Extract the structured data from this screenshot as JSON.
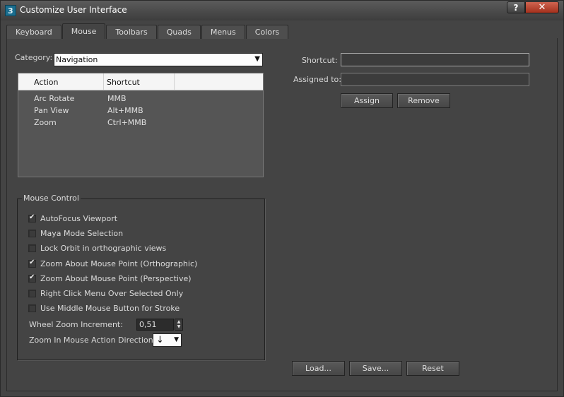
{
  "window": {
    "title": "Customize User Interface",
    "help_glyph": "?",
    "close_glyph": "✕"
  },
  "tabs": [
    {
      "label": "Keyboard",
      "active": false
    },
    {
      "label": "Mouse",
      "active": true
    },
    {
      "label": "Toolbars",
      "active": false
    },
    {
      "label": "Quads",
      "active": false
    },
    {
      "label": "Menus",
      "active": false
    },
    {
      "label": "Colors",
      "active": false
    }
  ],
  "category": {
    "label": "Category:",
    "value": "Navigation"
  },
  "action_list": {
    "columns": [
      "Action",
      "Shortcut"
    ],
    "rows": [
      {
        "action": "Arc Rotate",
        "shortcut": "MMB"
      },
      {
        "action": "Pan View",
        "shortcut": "Alt+MMB"
      },
      {
        "action": "Zoom",
        "shortcut": "Ctrl+MMB"
      }
    ]
  },
  "shortcut_panel": {
    "shortcut_label": "Shortcut:",
    "shortcut_value": "",
    "assigned_label": "Assigned to:",
    "assigned_value": "",
    "assign_button": "Assign",
    "remove_button": "Remove"
  },
  "mouse_control": {
    "title": "Mouse Control",
    "options": [
      {
        "label": "AutoFocus Viewport",
        "checked": true
      },
      {
        "label": "Maya Mode Selection",
        "checked": false
      },
      {
        "label": "Lock Orbit in orthographic views",
        "checked": false
      },
      {
        "label": "Zoom About Mouse Point (Orthographic)",
        "checked": true
      },
      {
        "label": "Zoom About Mouse Point (Perspective)",
        "checked": true
      },
      {
        "label": "Right Click Menu Over Selected Only",
        "checked": false
      },
      {
        "label": "Use Middle Mouse Button for Stroke",
        "checked": false
      }
    ],
    "wheel_zoom_label": "Wheel Zoom Increment:",
    "wheel_zoom_value": "0,51",
    "zoom_direction_label": "Zoom In Mouse Action Direction:",
    "zoom_direction_value": "↓"
  },
  "footer": {
    "load_button": "Load...",
    "save_button": "Save...",
    "reset_button": "Reset"
  },
  "colors": {
    "background": "#444444",
    "close_button": "#c0412b",
    "icon_accent": "#1b6e8f"
  }
}
